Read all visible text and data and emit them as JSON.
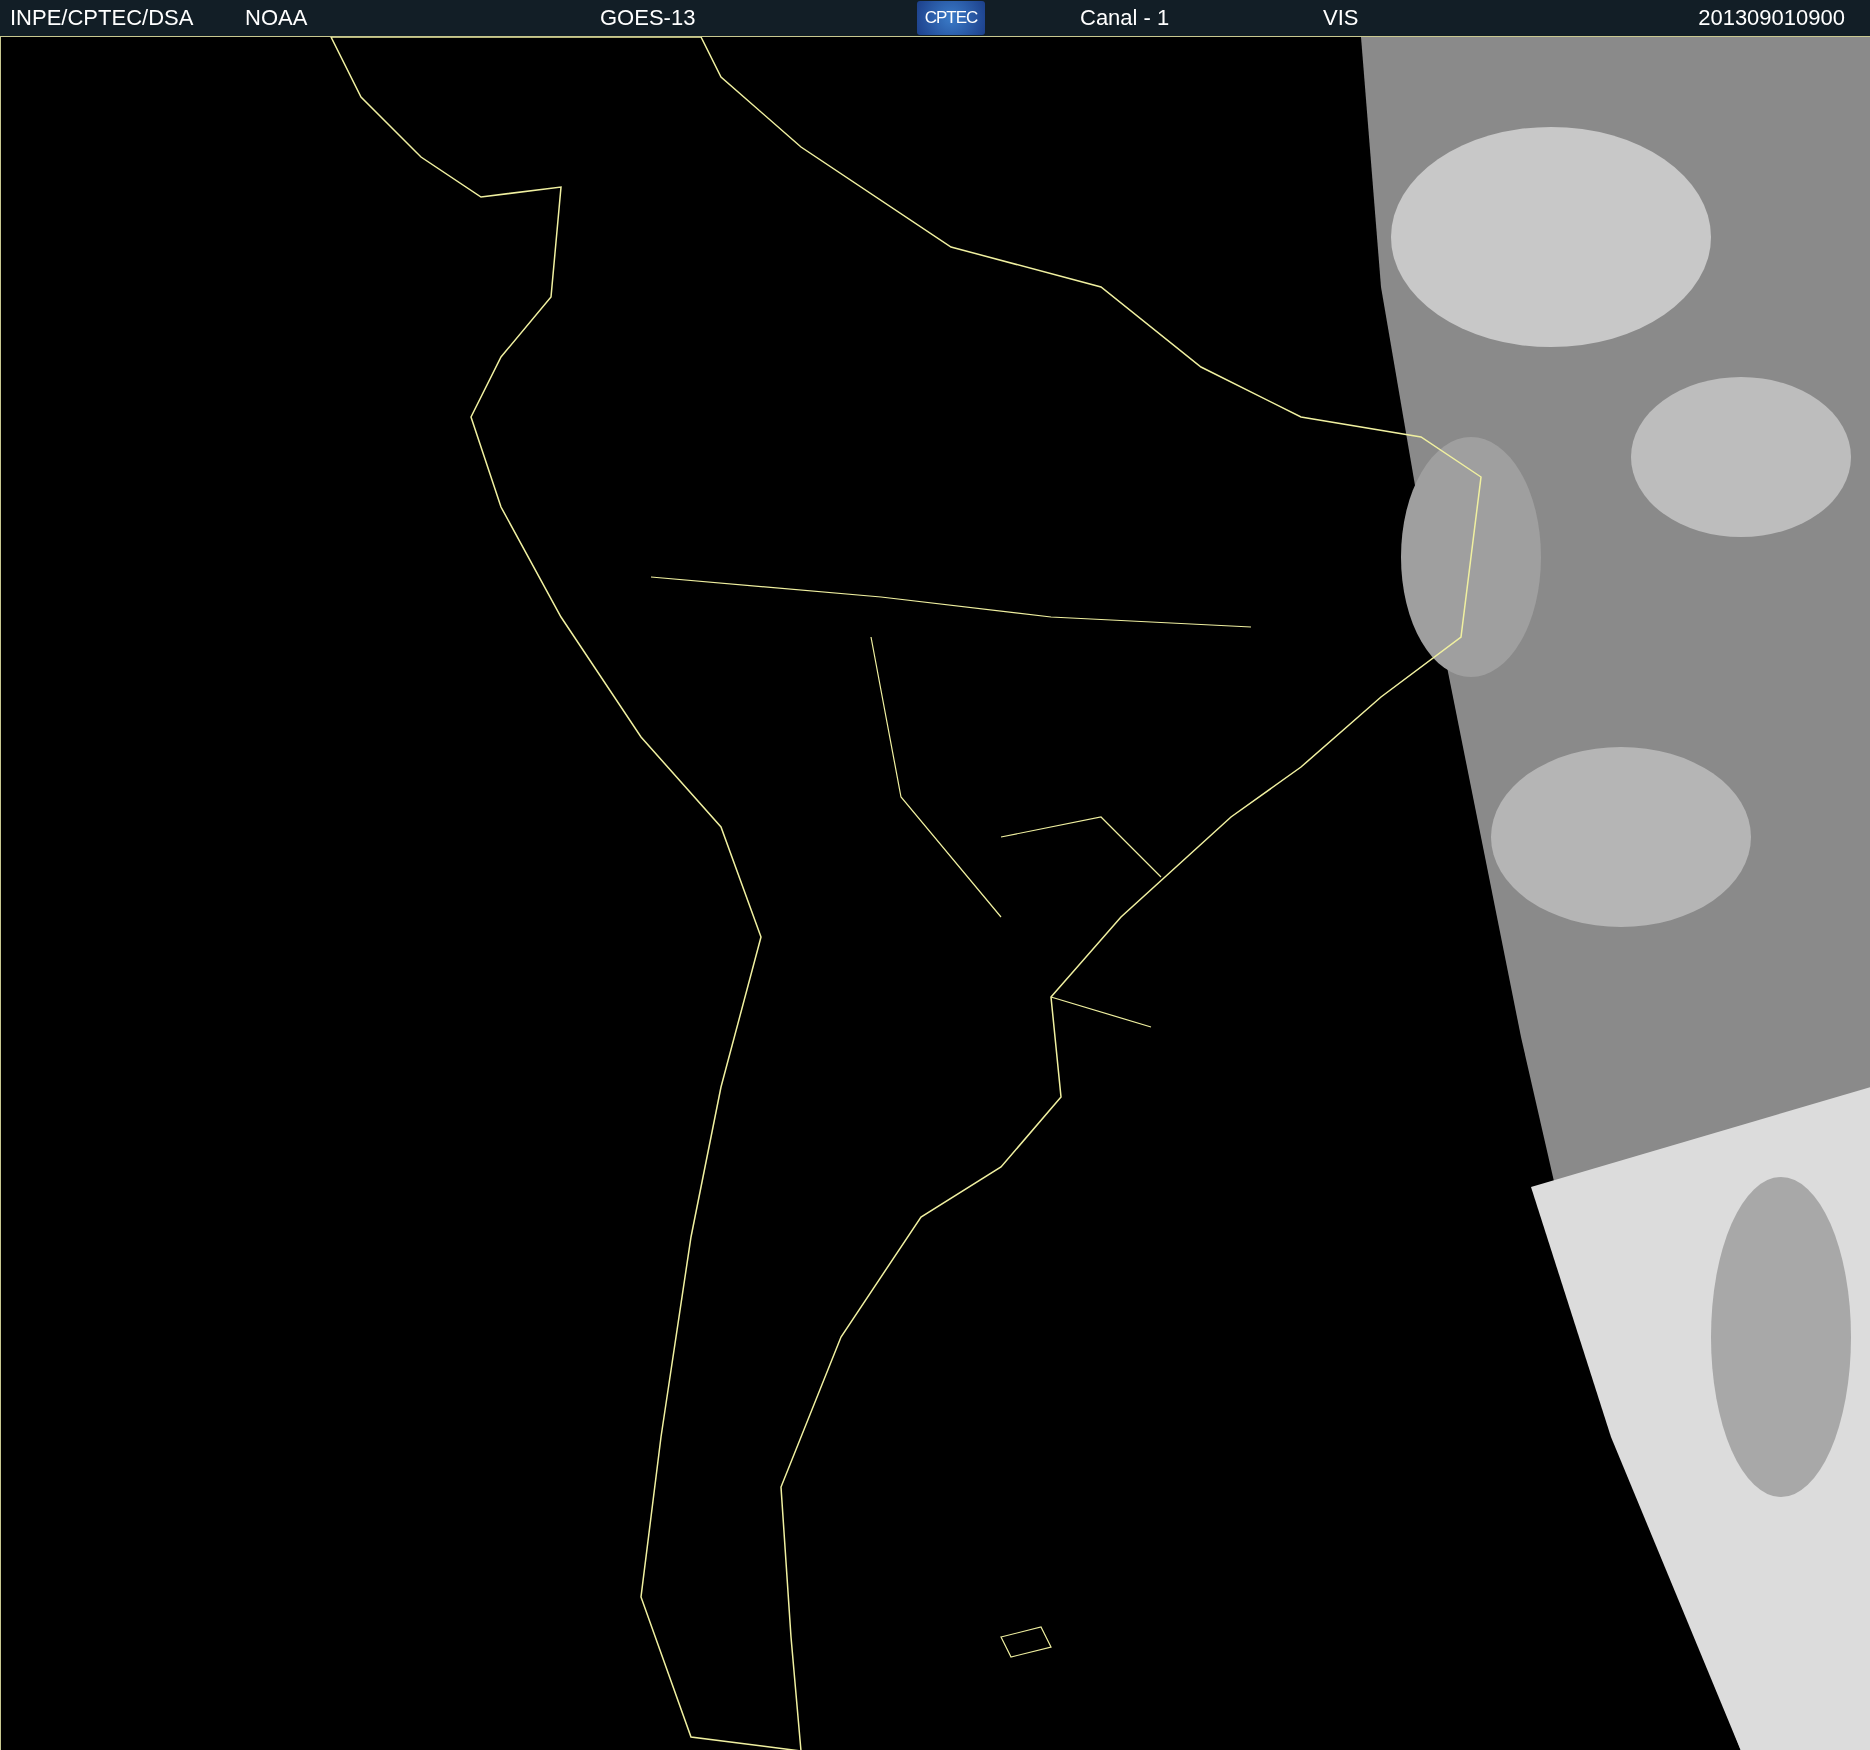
{
  "header": {
    "source": "INPE/CPTEC/DSA",
    "agency": "NOAA",
    "satellite": "GOES-13",
    "logo": "CPTEC",
    "channel": "Canal - 1",
    "band": "VIS",
    "timestamp": "201309010900"
  }
}
